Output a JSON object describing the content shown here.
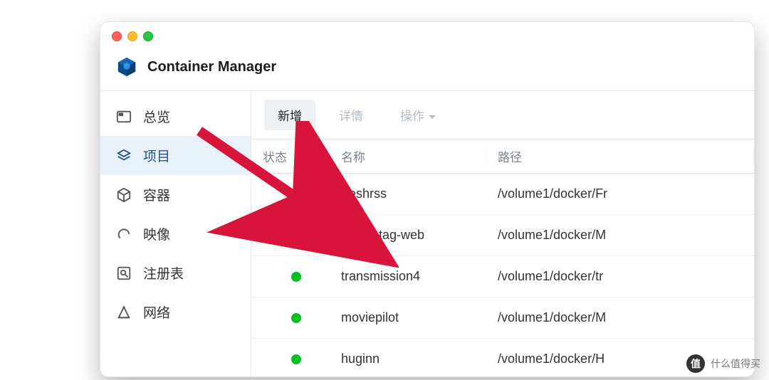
{
  "app": {
    "title": "Container Manager"
  },
  "sidebar": {
    "items": [
      {
        "label": "总览",
        "icon": "overview"
      },
      {
        "label": "项目",
        "icon": "project",
        "active": true
      },
      {
        "label": "容器",
        "icon": "container"
      },
      {
        "label": "映像",
        "icon": "image"
      },
      {
        "label": "注册表",
        "icon": "registry"
      },
      {
        "label": "网络",
        "icon": "network"
      }
    ]
  },
  "toolbar": {
    "new_label": "新增",
    "detail_label": "详情",
    "action_label": "操作"
  },
  "grid": {
    "headers": {
      "status": "状态",
      "name": "名称",
      "path": "路径"
    },
    "rows": [
      {
        "status": "running",
        "name": "freshrss",
        "path": "/volume1/docker/Fr"
      },
      {
        "status": "running",
        "name": "music-tag-web",
        "path": "/volume1/docker/M"
      },
      {
        "status": "running",
        "name": "transmission4",
        "path": "/volume1/docker/tr"
      },
      {
        "status": "running",
        "name": "moviepilot",
        "path": "/volume1/docker/M"
      },
      {
        "status": "running",
        "name": "huginn",
        "path": "/volume1/docker/H"
      }
    ]
  },
  "watermark": {
    "badge": "值",
    "text": "什么值得买"
  },
  "annotation": {
    "arrow_color": "#d8143a"
  }
}
